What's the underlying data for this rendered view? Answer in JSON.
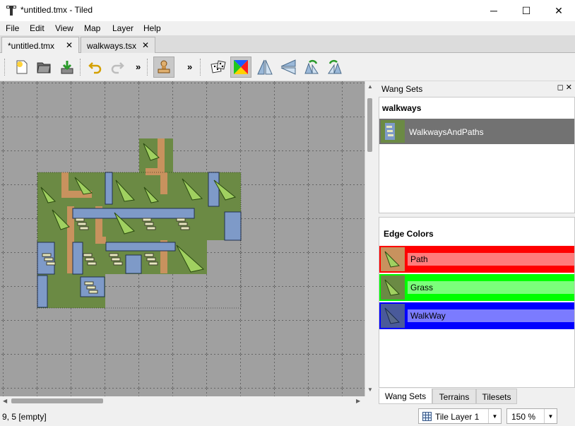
{
  "window": {
    "title": "*untitled.tmx - Tiled",
    "minimize": "─",
    "maximize": "☐",
    "close": "✕"
  },
  "menu": [
    "File",
    "Edit",
    "View",
    "Map",
    "Layer",
    "Help"
  ],
  "tabs": [
    {
      "label": "*untitled.tmx",
      "close": "✕"
    },
    {
      "label": "walkways.tsx",
      "close": "✕"
    }
  ],
  "toolbar": {
    "more": "»"
  },
  "dock": {
    "title": "Wang Sets",
    "float": "◻",
    "close": "✕",
    "wang_heading": "walkways",
    "wang_sets": [
      "WalkwaysAndPaths"
    ],
    "edge_heading": "Edge Colors",
    "edge_colors": [
      {
        "label": "Path",
        "color": "#ff0000",
        "light": "#ff7b7b"
      },
      {
        "label": "Grass",
        "color": "#00ff00",
        "light": "#7bff7b"
      },
      {
        "label": "WalkWay",
        "color": "#0000ff",
        "light": "#7b7bff"
      }
    ],
    "tabs": [
      "Wang Sets",
      "Terrains",
      "Tilesets"
    ]
  },
  "status": {
    "position": "9, 5 [empty]",
    "layer": "Tile Layer 1",
    "zoom": "150 %"
  }
}
